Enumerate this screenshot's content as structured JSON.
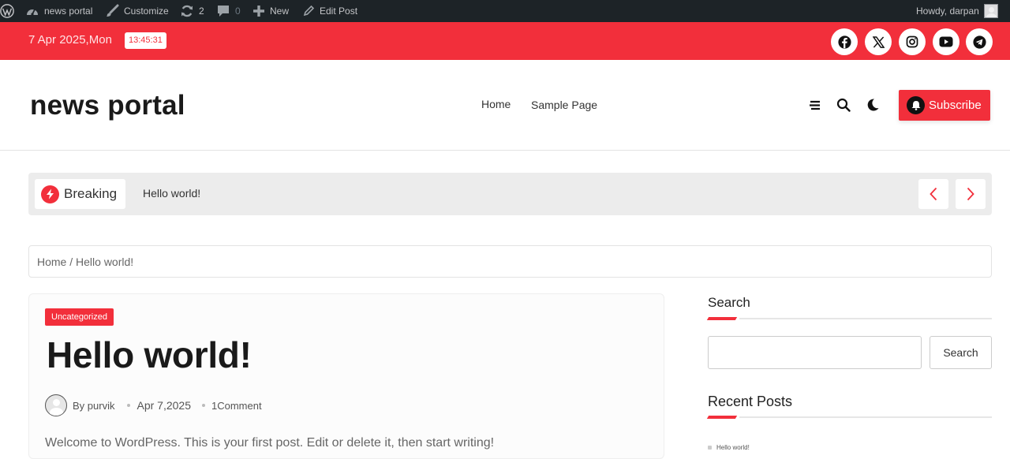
{
  "admin_bar": {
    "site_name": "news portal",
    "customize": "Customize",
    "updates_count": "2",
    "comments_count": "0",
    "new": "New",
    "edit_post": "Edit Post",
    "greeting": "Howdy, darpan"
  },
  "topbar": {
    "date": "7 Apr 2025,Mon",
    "time": "13:45:31",
    "social_icons": [
      "facebook-icon",
      "x-icon",
      "instagram-icon",
      "youtube-icon",
      "telegram-icon"
    ],
    "accent_color": "#f22f3b"
  },
  "header": {
    "site_title": "news portal",
    "nav": [
      "Home",
      "Sample Page"
    ],
    "subscribe_label": "Subscribe"
  },
  "breaking": {
    "label": "Breaking",
    "headline": "Hello world!"
  },
  "breadcrumb": {
    "home": "Home",
    "separator": "/",
    "current": "Hello world!"
  },
  "post": {
    "category": "Uncategorized",
    "title": "Hello world!",
    "author_prefix": "By",
    "author": "purvik",
    "date": "Apr 7,2025",
    "comments": "1Comment",
    "excerpt": "Welcome to WordPress. This is your first post. Edit or delete it, then start writing!"
  },
  "sidebar": {
    "search_title": "Search",
    "search_value": "",
    "search_button": "Search",
    "recent_title": "Recent Posts",
    "recent_posts": [
      "Hello world!"
    ]
  }
}
